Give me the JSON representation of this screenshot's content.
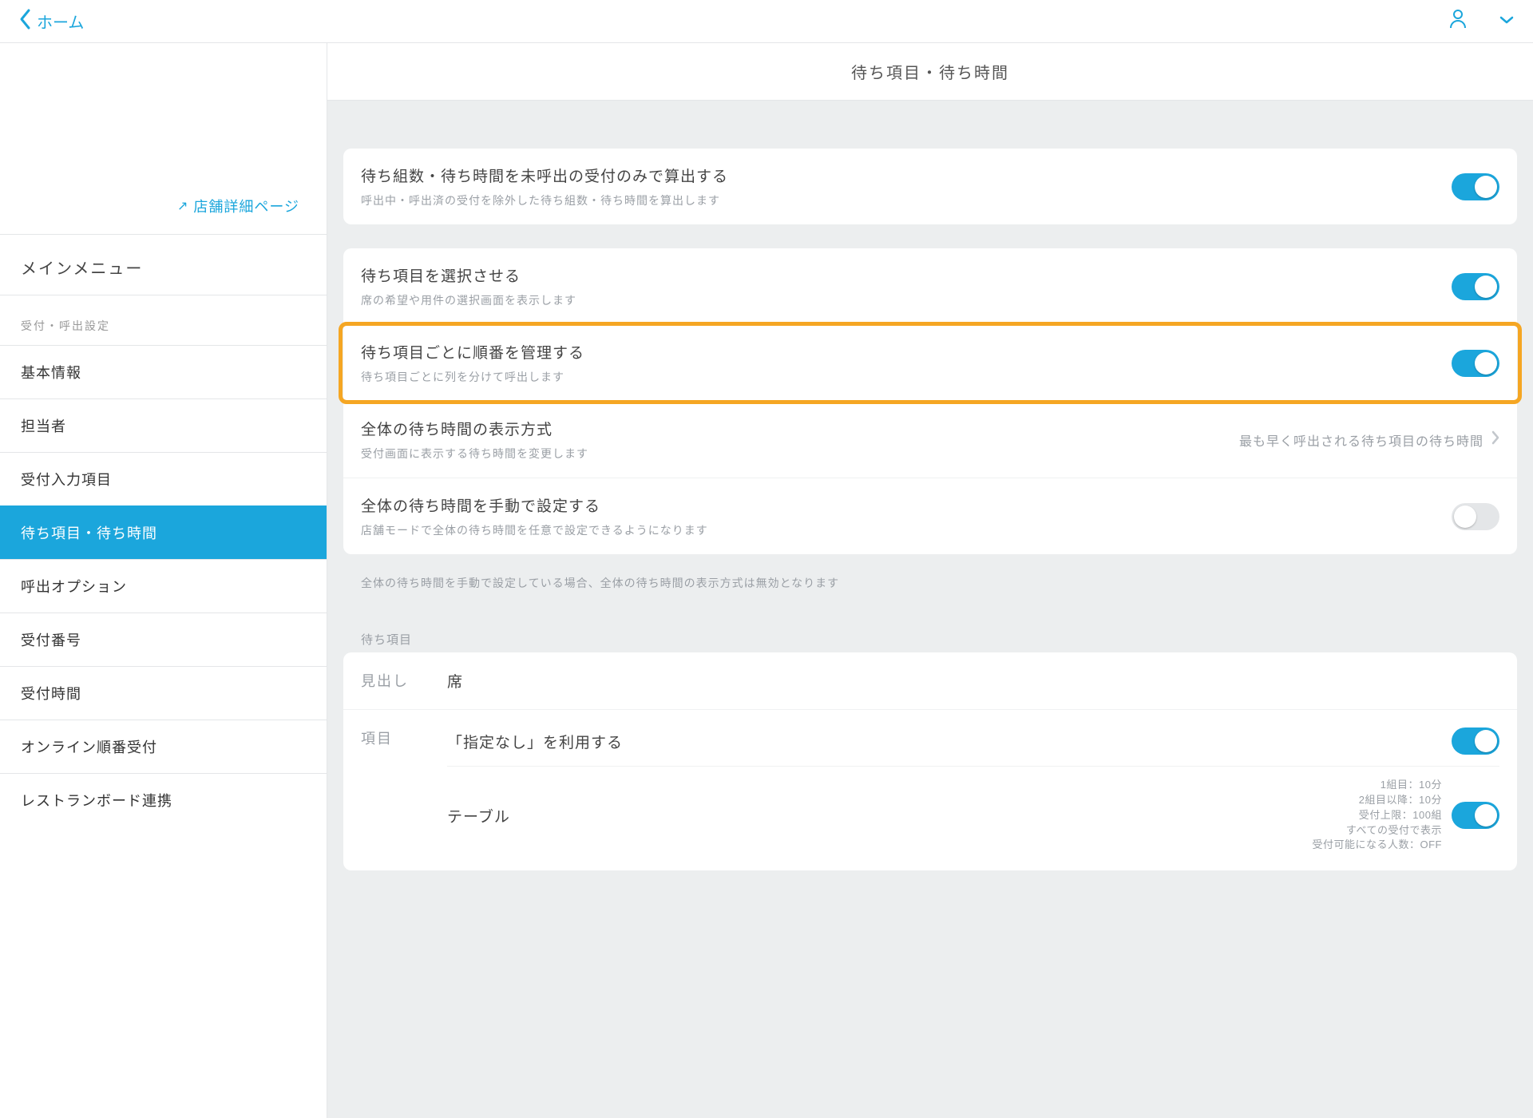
{
  "colors": {
    "accent": "#1ba6dc",
    "highlight": "#f5a623"
  },
  "topbar": {
    "back_label": "ホーム"
  },
  "sidebar": {
    "ext_link": "店舗詳細ページ",
    "main_menu_label": "メインメニュー",
    "section_label": "受付・呼出設定",
    "items": [
      {
        "label": "基本情報",
        "active": false
      },
      {
        "label": "担当者",
        "active": false
      },
      {
        "label": "受付入力項目",
        "active": false
      },
      {
        "label": "待ち項目・待ち時間",
        "active": true
      },
      {
        "label": "呼出オプション",
        "active": false
      },
      {
        "label": "受付番号",
        "active": false
      },
      {
        "label": "受付時間",
        "active": false
      },
      {
        "label": "オンライン順番受付",
        "active": false
      },
      {
        "label": "レストランボード連携",
        "active": false
      }
    ]
  },
  "content": {
    "title": "待ち項目・待ち時間",
    "card1": {
      "row": {
        "title": "待ち組数・待ち時間を未呼出の受付のみで算出する",
        "desc": "呼出中・呼出済の受付を除外した待ち組数・待ち時間を算出します",
        "on": true
      }
    },
    "card2": {
      "rows": [
        {
          "title": "待ち項目を選択させる",
          "desc": "席の希望や用件の選択画面を表示します",
          "type": "toggle",
          "on": true,
          "highlight": false
        },
        {
          "title": "待ち項目ごとに順番を管理する",
          "desc": "待ち項目ごとに列を分けて呼出します",
          "type": "toggle",
          "on": true,
          "highlight": true
        },
        {
          "title": "全体の待ち時間の表示方式",
          "desc": "受付画面に表示する待ち時間を変更します",
          "type": "nav",
          "value": "最も早く呼出される待ち項目の待ち時間"
        },
        {
          "title": "全体の待ち時間を手動で設定する",
          "desc": "店舗モードで全体の待ち時間を任意で設定できるようになります",
          "type": "toggle",
          "on": false
        }
      ],
      "footnote": "全体の待ち時間を手動で設定している場合、全体の待ち時間の表示方式は無効となります"
    },
    "card3": {
      "heading": "待ち項目",
      "row_heading": {
        "key": "見出し",
        "val": "席"
      },
      "row_items_key": "項目",
      "entries": [
        {
          "label": "「指定なし」を利用する",
          "type": "toggle",
          "on": true
        },
        {
          "label": "テーブル",
          "type": "detail",
          "on": true,
          "details": [
            "1組目：10分",
            "2組目以降：10分",
            "受付上限：100組",
            "すべての受付で表示",
            "受付可能になる人数：OFF"
          ]
        }
      ]
    }
  }
}
